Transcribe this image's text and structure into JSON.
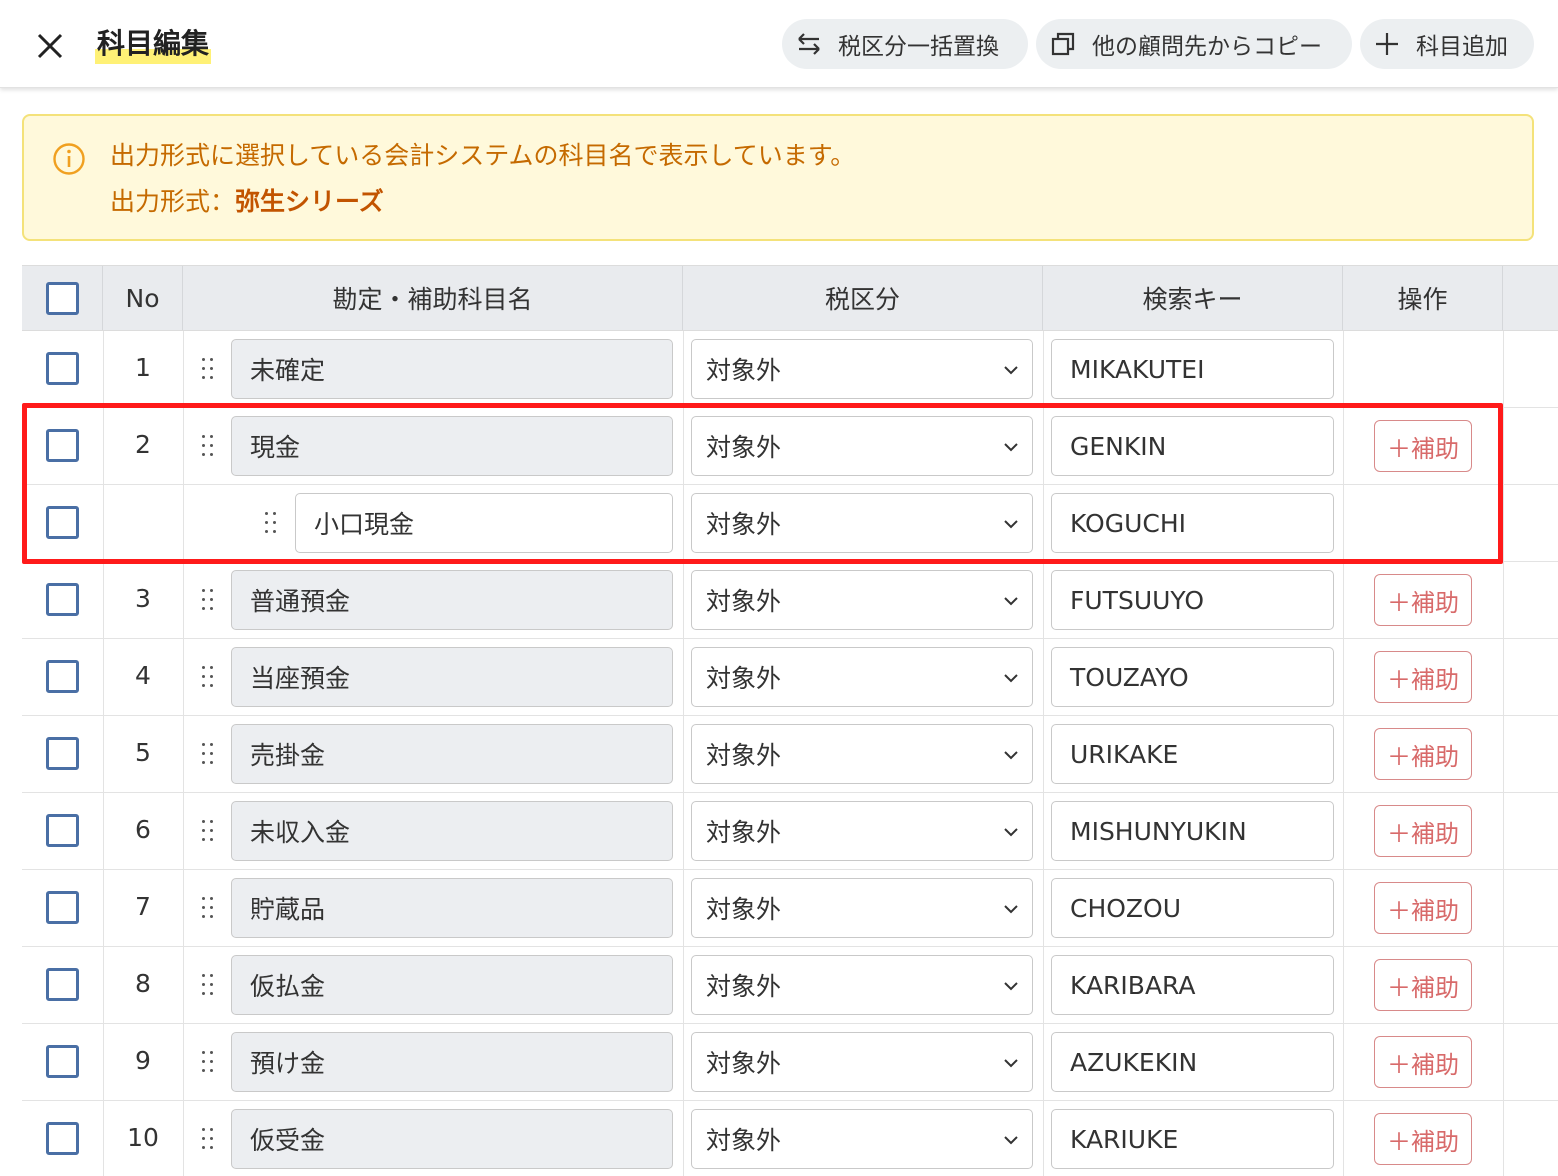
{
  "header": {
    "title": "科目編集",
    "buttons": {
      "tax_replace": "税区分一括置換",
      "copy_from_other": "他の顧問先からコピー",
      "add_account": "科目追加"
    }
  },
  "notice": {
    "line1": "出力形式に選択している会計システムの科目名で表示しています。",
    "line2_prefix": "出力形式：",
    "line2_value": "弥生シリーズ"
  },
  "table": {
    "columns": {
      "no": "No",
      "name": "勘定・補助科目名",
      "tax": "税区分",
      "key": "検索キー",
      "action": "操作"
    },
    "add_sub_label": "＋補助",
    "rows": [
      {
        "no": "1",
        "name": "未確定",
        "tax": "対象外",
        "key": "MIKAKUTEI",
        "has_add": false
      },
      {
        "no": "2",
        "name": "現金",
        "tax": "対象外",
        "key": "GENKIN",
        "has_add": true
      },
      {
        "no": "",
        "name": "小口現金",
        "tax": "対象外",
        "key": "KOGUCHI",
        "has_add": false,
        "sub": true
      },
      {
        "no": "3",
        "name": "普通預金",
        "tax": "対象外",
        "key": "FUTSUUYO",
        "has_add": true
      },
      {
        "no": "4",
        "name": "当座預金",
        "tax": "対象外",
        "key": "TOUZAYO",
        "has_add": true
      },
      {
        "no": "5",
        "name": "売掛金",
        "tax": "対象外",
        "key": "URIKAKE",
        "has_add": true
      },
      {
        "no": "6",
        "name": "未収入金",
        "tax": "対象外",
        "key": "MISHUNYUKIN",
        "has_add": true
      },
      {
        "no": "7",
        "name": "貯蔵品",
        "tax": "対象外",
        "key": "CHOZOU",
        "has_add": true
      },
      {
        "no": "8",
        "name": "仮払金",
        "tax": "対象外",
        "key": "KARIBARA",
        "has_add": true
      },
      {
        "no": "9",
        "name": "預け金",
        "tax": "対象外",
        "key": "AZUKEKIN",
        "has_add": true
      },
      {
        "no": "10",
        "name": "仮受金",
        "tax": "対象外",
        "key": "KARIUKE",
        "has_add": true
      }
    ]
  },
  "colors": {
    "highlight": "#ff1a1a",
    "notice_text": "#c56a00",
    "add_button": "#d86a6a"
  }
}
